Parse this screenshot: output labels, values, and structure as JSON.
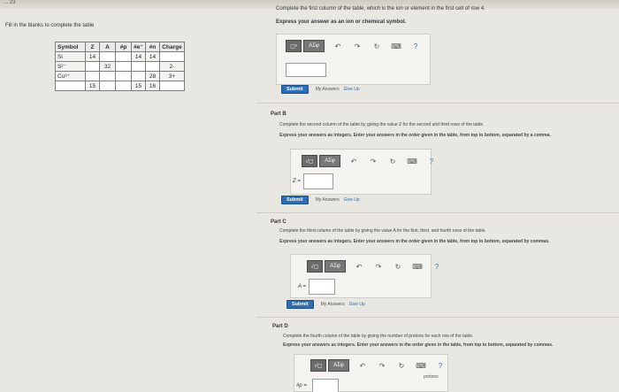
{
  "window": {
    "top_text": "... 23"
  },
  "left": {
    "instruction": "Fill in the blanks to complete the table",
    "table": {
      "headers": [
        "Symbol",
        "Z",
        "A",
        "#p",
        "#e⁻",
        "#n",
        "Charge"
      ],
      "rows": [
        [
          "Si",
          "14",
          "",
          "",
          "14",
          "14",
          ""
        ],
        [
          "S²⁻",
          "",
          "32",
          "",
          "",
          "",
          "2-"
        ],
        [
          "Cu³⁺",
          "",
          "",
          "",
          "",
          "28",
          "3+"
        ],
        [
          "",
          "15",
          "",
          "",
          "15",
          "16",
          ""
        ]
      ]
    }
  },
  "part_a": {
    "prompt": "Complete the first column of the table, which is the ion or element in the first cell of row 4.",
    "express": "Express your answer as an ion or chemical symbol.",
    "toolbar": {
      "templates": "▢ⁿ",
      "greek": "AΣφ",
      "undo": "↶",
      "redo": "↷",
      "reset": "↻",
      "keyboard": "⌨",
      "help": "?"
    },
    "input_value": "",
    "submit": "Submit",
    "my_answers": "My Answers",
    "give_up": "Give Up"
  },
  "part_b": {
    "title": "Part B",
    "prompt": "Complete the second column of the table by giving the value Z for the second and third rows of the table.",
    "express": "Express your answers as integers. Enter your answers in the order given in the table, from top to bottom, separated by a comma.",
    "toolbar": {
      "templates": "√▢",
      "greek": "AΣφ",
      "undo": "↶",
      "redo": "↷",
      "reset": "↻",
      "keyboard": "⌨",
      "help": "?"
    },
    "input_label": "Z =",
    "input_value": "",
    "submit": "Submit",
    "my_answers": "My Answers",
    "give_up": "Give Up"
  },
  "part_c": {
    "title": "Part C",
    "prompt": "Complete the third column of the table by giving the value A for the first, third, and fourth rows of the table.",
    "express": "Express your answers as integers. Enter your answers in the order given in the table, from top to bottom, separated by commas.",
    "toolbar": {
      "templates": "√▢",
      "greek": "AΣφ",
      "undo": "↶",
      "redo": "↷",
      "reset": "↻",
      "keyboard": "⌨",
      "help": "?"
    },
    "input_label": "A =",
    "input_value": "",
    "submit": "Submit",
    "my_answers": "My Answers",
    "give_up": "Give Up"
  },
  "part_d": {
    "title": "Part D",
    "prompt": "Complete the fourth column of the table by giving the number of protons for each row of the table.",
    "express": "Express your answers as integers. Enter your answers in the order given in the table, from top to bottom, separated by commas.",
    "toolbar": {
      "templates": "√▢",
      "greek": "AΣφ",
      "undo": "↶",
      "redo": "↷",
      "reset": "↻",
      "keyboard": "⌨",
      "help": "?"
    },
    "input_label": "#p =",
    "input_value": "",
    "unit": "protons"
  }
}
